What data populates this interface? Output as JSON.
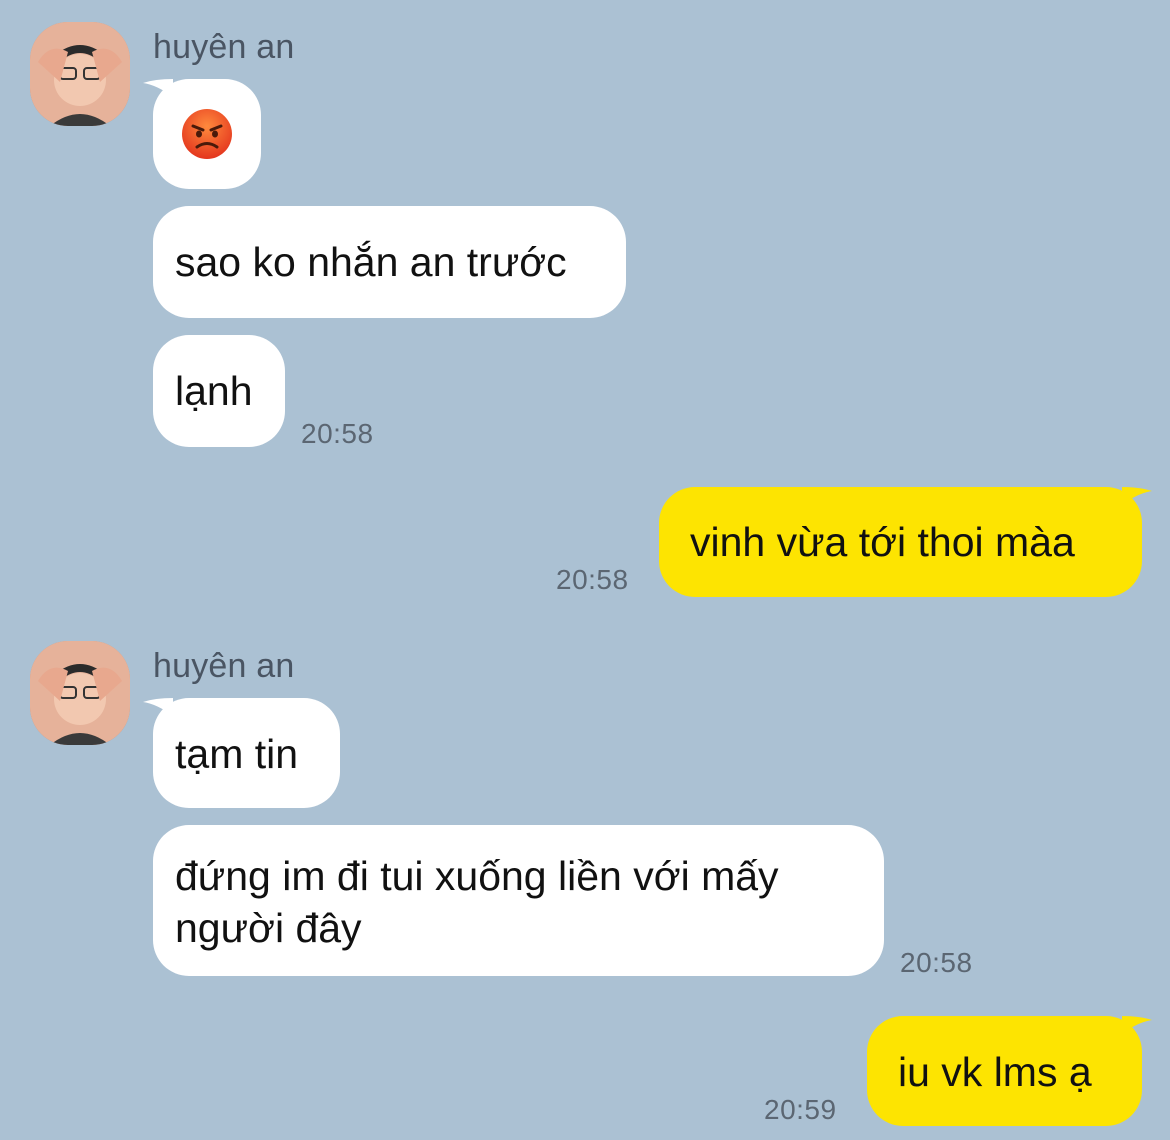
{
  "chat": {
    "colors": {
      "background": "#abc1d3",
      "incoming_bubble": "#ffffff",
      "outgoing_bubble": "#fde401"
    },
    "groups": [
      {
        "sender": "huyên an",
        "avatar_icon": "profile-photo-heart-hands",
        "messages": [
          {
            "emoji": "angry-face-icon",
            "text": ""
          },
          {
            "text": "sao ko nhắn an trước"
          },
          {
            "text": "lạnh",
            "time": "20:58"
          }
        ]
      },
      {
        "sender": "me",
        "messages": [
          {
            "text": "vinh vừa tới thoi màa",
            "time": "20:58"
          }
        ]
      },
      {
        "sender": "huyên an",
        "avatar_icon": "profile-photo-heart-hands",
        "messages": [
          {
            "text": "tạm tin"
          },
          {
            "text": "đứng im đi tui xuống liền với mấy",
            "text_line2": "người đây",
            "time": "20:58"
          }
        ]
      },
      {
        "sender": "me",
        "messages": [
          {
            "text": "iu vk lms ạ",
            "time": "20:59"
          }
        ]
      }
    ]
  }
}
